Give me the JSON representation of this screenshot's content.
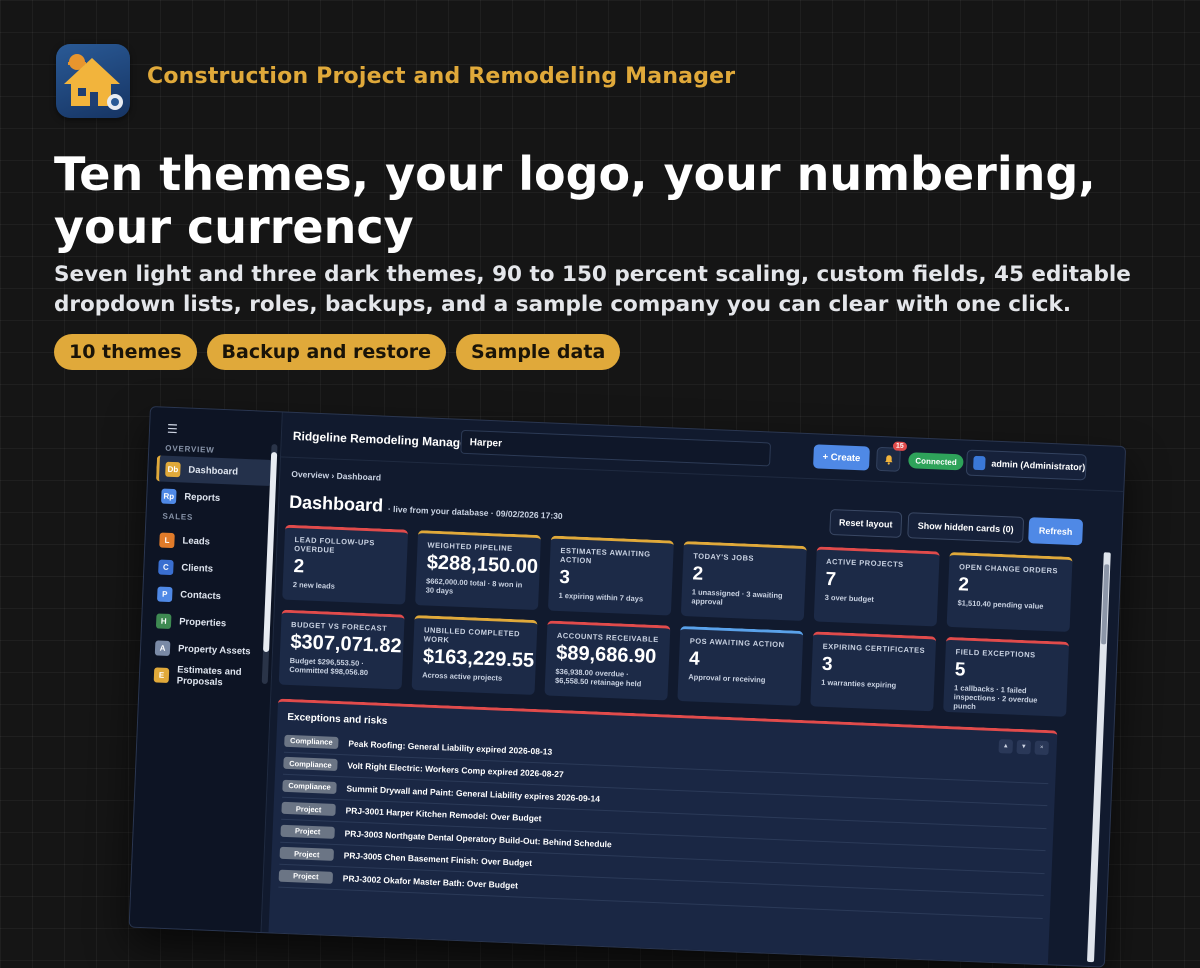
{
  "hero": {
    "app_name": "Construction Project and Remodeling Manager",
    "headline": "Ten themes, your logo, your numbering, your currency",
    "subhead": "Seven light and three dark themes, 90 to 150 percent scaling, custom fields, 45 editable dropdown lists, roles, backups, and a sample company you can clear with one click.",
    "pills": [
      "10 themes",
      "Backup and restore",
      "Sample data"
    ],
    "accent_color": "#e0a93a"
  },
  "app": {
    "brand": "Ridgeline Remodeling Manager",
    "search_value": "Harper",
    "create_label": "+ Create",
    "notification_count": "15",
    "status": "Connected",
    "user": "admin (Administrator)",
    "breadcrumb": "Overview › Dashboard",
    "page_title": "Dashboard",
    "page_subtitle": "· live from your database · 09/02/2026 17:30",
    "toolbar": {
      "reset_layout": "Reset layout",
      "show_hidden": "Show hidden cards (0)",
      "refresh": "Refresh"
    }
  },
  "sidebar": {
    "sections": [
      {
        "title": "OVERVIEW",
        "items": [
          {
            "icon": "Db",
            "label": "Dashboard",
            "color": "#e0a93a"
          },
          {
            "icon": "Rp",
            "label": "Reports",
            "color": "#4f89e6"
          }
        ]
      },
      {
        "title": "SALES",
        "items": [
          {
            "icon": "L",
            "label": "Leads",
            "color": "#e07b2a"
          },
          {
            "icon": "C",
            "label": "Clients",
            "color": "#3a6fd0"
          },
          {
            "icon": "P",
            "label": "Contacts",
            "color": "#4f89e6"
          },
          {
            "icon": "H",
            "label": "Properties",
            "color": "#3e8a52"
          },
          {
            "icon": "A",
            "label": "Property Assets",
            "color": "#7a8aa6"
          },
          {
            "icon": "E",
            "label": "Estimates and Proposals",
            "color": "#e0a93a"
          }
        ]
      }
    ]
  },
  "cards": [
    {
      "title": "Lead follow-ups overdue",
      "value": "2",
      "note": "2 new leads",
      "accent": "red"
    },
    {
      "title": "Weighted pipeline",
      "value": "$288,150.00",
      "note": "$662,000.00 total · 8 won in 30 days",
      "accent": "yellow"
    },
    {
      "title": "Estimates awaiting action",
      "value": "3",
      "note": "1 expiring within 7 days",
      "accent": "yellow"
    },
    {
      "title": "Today's jobs",
      "value": "2",
      "note": "1 unassigned · 3 awaiting approval",
      "accent": "yellow"
    },
    {
      "title": "Active projects",
      "value": "7",
      "note": "3 over budget",
      "accent": "red"
    },
    {
      "title": "Open change orders",
      "value": "2",
      "note": "$1,510.40 pending value",
      "accent": "yellow"
    },
    {
      "title": "Budget vs forecast",
      "value": "$307,071.82",
      "note": "Budget $296,553.50 · Committed $98,056.80",
      "accent": "red"
    },
    {
      "title": "Unbilled completed work",
      "value": "$163,229.55",
      "note": "Across active projects",
      "accent": "yellow"
    },
    {
      "title": "Accounts receivable",
      "value": "$89,686.90",
      "note": "$36,938.00 overdue · $6,558.50 retainage held",
      "accent": "red"
    },
    {
      "title": "POs awaiting action",
      "value": "4",
      "note": "Approval or receiving",
      "accent": "blue"
    },
    {
      "title": "Expiring certificates",
      "value": "3",
      "note": "1 warranties expiring",
      "accent": "red"
    },
    {
      "title": "Field exceptions",
      "value": "5",
      "note": "1 callbacks · 1 failed inspections · 2 overdue punch",
      "accent": "red"
    }
  ],
  "exceptions": {
    "title": "Exceptions and risks",
    "controls": [
      "▲",
      "▼",
      "×"
    ],
    "rows": [
      {
        "tag": "Compliance",
        "text": "Peak Roofing: General Liability expired 2026-08-13"
      },
      {
        "tag": "Compliance",
        "text": "Volt Right Electric: Workers Comp expired 2026-08-27"
      },
      {
        "tag": "Compliance",
        "text": "Summit Drywall and Paint: General Liability expires 2026-09-14"
      },
      {
        "tag": "Project",
        "text": "PRJ-3001 Harper Kitchen Remodel: Over Budget"
      },
      {
        "tag": "Project",
        "text": "PRJ-3003 Northgate Dental Operatory Build-Out: Behind Schedule"
      },
      {
        "tag": "Project",
        "text": "PRJ-3005 Chen Basement Finish: Over Budget"
      },
      {
        "tag": "Project",
        "text": "PRJ-3002 Okafor Master Bath: Over Budget"
      }
    ]
  }
}
